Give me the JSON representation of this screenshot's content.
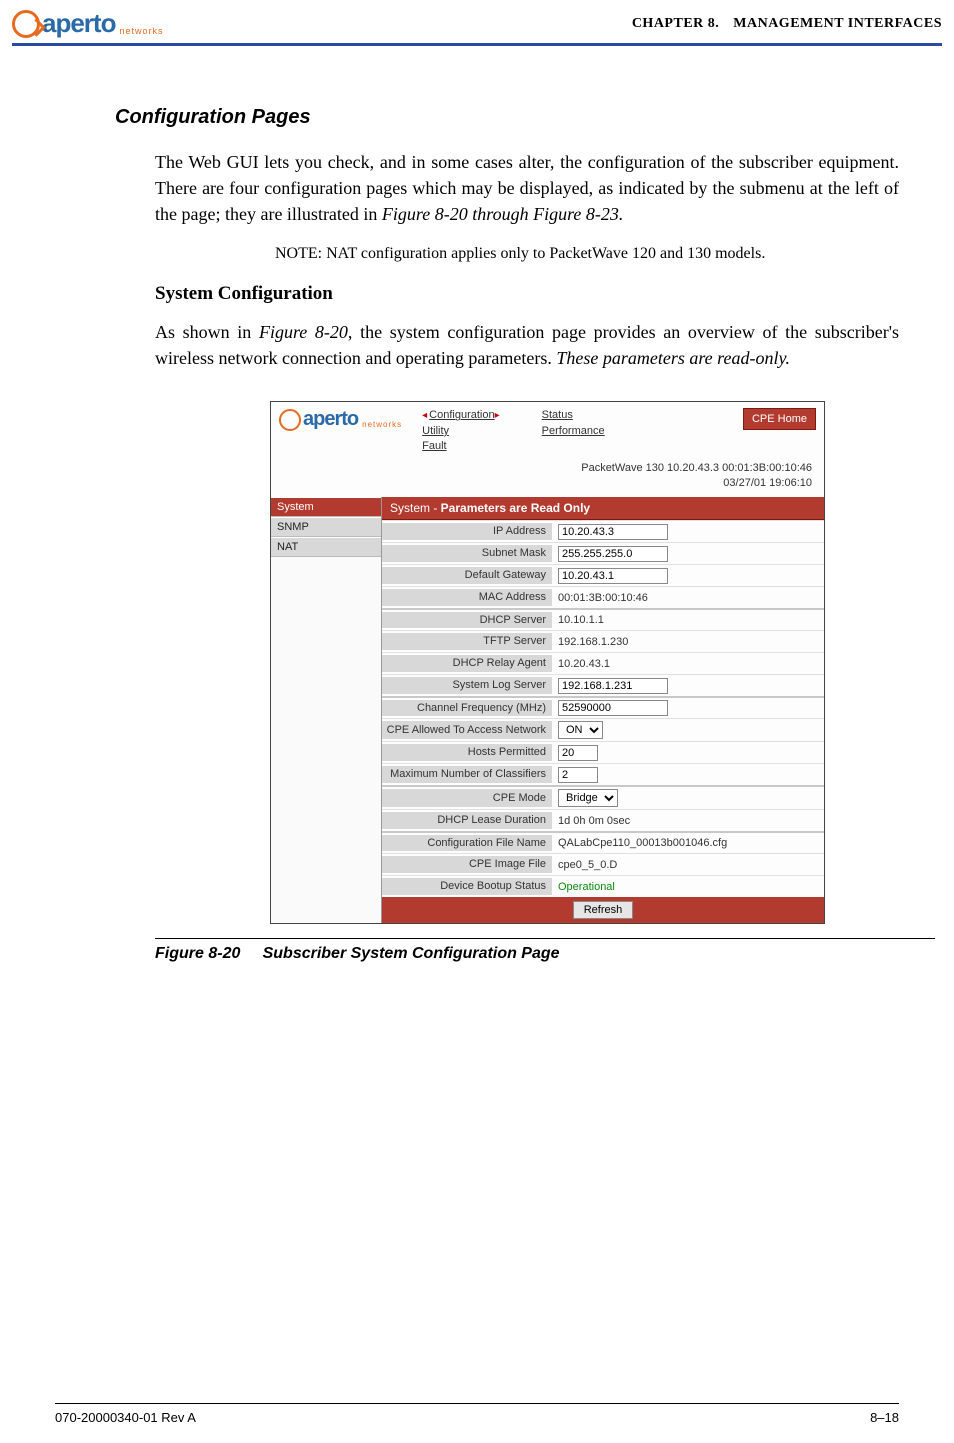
{
  "header": {
    "logo_text": "aperto",
    "logo_sub": "networks",
    "chapter": "CHAPTER 8.",
    "chapter_title": "MANAGEMENT INTERFACES"
  },
  "section_title": "Configuration Pages",
  "para1_a": "The Web GUI lets you check, and in some cases alter, the configuration of the subscriber equipment. There are four configuration pages which may be displayed, as indicated by the submenu at the left of the page; they are illustrated in ",
  "para1_ref": "Figure 8-20 through Figure 8-23.",
  "note_prefix": "NOTE:  ",
  "note_text": "NAT configuration applies only to PacketWave 120 and 130 models.",
  "subhead": "System Configuration",
  "para2_a": "As shown in ",
  "para2_ref": "Figure 8-20",
  "para2_b": ", the system configuration page provides an overview of the subscriber's wireless network connection and operating parameters. ",
  "para2_ital": "These parameters are read-only.",
  "figure": {
    "logo_text": "aperto",
    "logo_sub": "networks",
    "tabs": {
      "col1": [
        "Configuration",
        "Utility",
        "Fault"
      ],
      "col2": [
        "Status",
        "Performance"
      ]
    },
    "cpe_home": "CPE Home",
    "info_line1": "PacketWave 130    10.20.43.3    00:01:3B:00:10:46",
    "info_line2": "03/27/01    19:06:10",
    "sidebar": [
      "System",
      "SNMP",
      "NAT"
    ],
    "panel_title_a": "System - ",
    "panel_title_b": "Parameters are Read Only",
    "rows": {
      "ip_lbl": "IP Address",
      "ip_val": "10.20.43.3",
      "mask_lbl": "Subnet Mask",
      "mask_val": "255.255.255.0",
      "gw_lbl": "Default Gateway",
      "gw_val": "10.20.43.1",
      "mac_lbl": "MAC Address",
      "mac_val": "00:01:3B:00:10:46",
      "dhcp_lbl": "DHCP Server",
      "dhcp_val": "10.10.1.1",
      "tftp_lbl": "TFTP Server",
      "tftp_val": "192.168.1.230",
      "relay_lbl": "DHCP Relay Agent",
      "relay_val": "10.20.43.1",
      "syslog_lbl": "System Log Server",
      "syslog_val": "192.168.1.231",
      "freq_lbl": "Channel Frequency (MHz)",
      "freq_val": "52590000",
      "allow_lbl": "CPE Allowed To Access Network",
      "allow_val": "ON",
      "hosts_lbl": "Hosts Permitted",
      "hosts_val": "20",
      "maxcls_lbl": "Maximum Number of Classifiers",
      "maxcls_val": "2",
      "mode_lbl": "CPE Mode",
      "mode_val": "Bridge",
      "lease_lbl": "DHCP Lease Duration",
      "lease_val": "1d 0h 0m 0sec",
      "cfg_lbl": "Configuration File Name",
      "cfg_val": "QALabCpe110_00013b001046.cfg",
      "img_lbl": "CPE Image File",
      "img_val": "cpe0_5_0.D",
      "boot_lbl": "Device Bootup Status",
      "boot_val": "Operational"
    },
    "refresh": "Refresh"
  },
  "caption_ref": "Figure 8-20",
  "caption_text": "Subscriber System Configuration Page",
  "footer": {
    "left": "070-20000340-01 Rev A",
    "right": "8–18"
  }
}
